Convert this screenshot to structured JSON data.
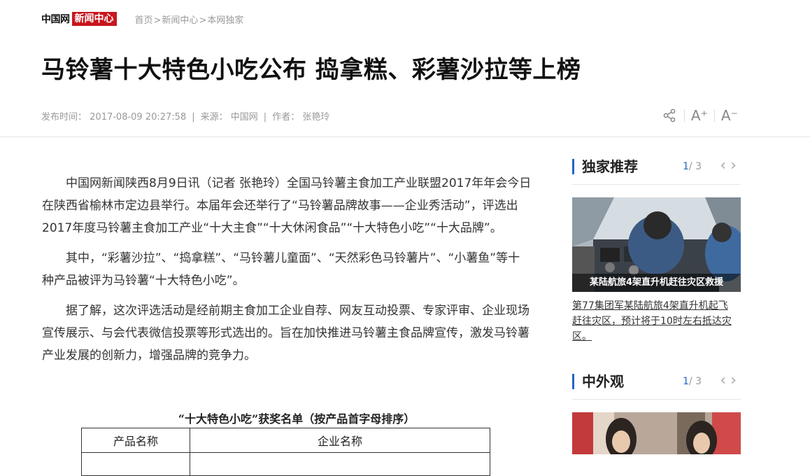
{
  "header": {
    "logo": "中国网",
    "badge": "新闻中心",
    "breadcrumb": [
      "首页",
      "新闻中心",
      "本网独家"
    ]
  },
  "article": {
    "title": "马铃薯十大特色小吃公布 捣拿糕、彩薯沙拉等上榜",
    "meta": {
      "time_label": "发布时间：",
      "time": "2017-08-09 20:27:58",
      "source_label": "来源：",
      "source": "中国网",
      "author_label": "作者：",
      "author": "张艳玲"
    },
    "paragraphs": [
      "中国网新闻陕西8月9日讯（记者 张艳玲）全国马铃薯主食加工产业联盟2017年年会今日在陕西省榆林市定边县举行。本届年会还举行了“马铃薯品牌故事——企业秀活动”，评选出2017年度马铃薯主食加工产业“十大主食”“十大休闲食品”“十大特色小吃”“十大品牌”。",
      "其中，“彩薯沙拉”、“捣拿糕”、“马铃薯儿童面”、“天然彩色马铃薯片”、“小薯鱼”等十种产品被评为马铃薯“十大特色小吃”。",
      "据了解，这次评选活动是经前期主食加工企业自荐、网友互动投票、专家评审、企业现场宣传展示、与会代表微信投票等形式选出的。旨在加快推进马铃薯主食品牌宣传，激发马铃薯产业发展的创新力，增强品牌的竞争力。"
    ],
    "table": {
      "title": "“十大特色小吃”获奖名单（按产品首字母排序）",
      "headers": [
        "产品名称",
        "企业名称"
      ]
    }
  },
  "tools": {
    "share_icon": "share-icon",
    "font_up": "A⁺",
    "font_down": "A⁻"
  },
  "sidebar": {
    "exclusive": {
      "title": "独家推荐",
      "page_current": "1",
      "page_total": "/ 3",
      "photo_caption": "某陆航旅4架直升机赶往灾区救援",
      "link": "第77集团军某陆航旅4架直升机起飞赶往灾区，预计将于10时左右抵达灾区。"
    },
    "world": {
      "title": "中外观",
      "page_current": "1",
      "page_total": "/ 3"
    }
  }
}
